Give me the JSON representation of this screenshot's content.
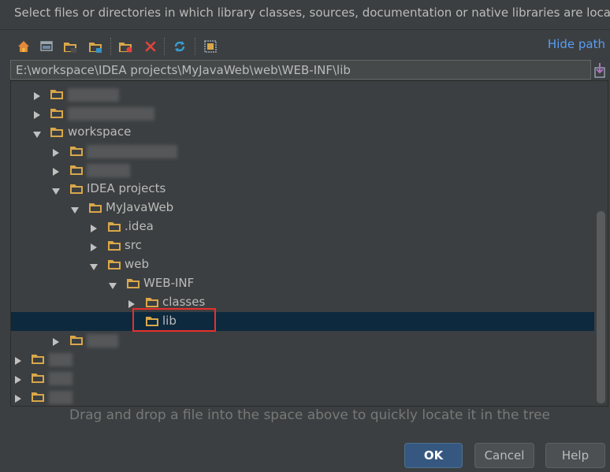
{
  "header": {
    "text": "Select files or directories in which library classes, sources, documentation or native libraries are located"
  },
  "toolbar": {
    "icons": [
      "home-icon",
      "desktop-icon",
      "project-folder-icon",
      "module-folder-icon",
      "new-folder-icon",
      "delete-icon",
      "refresh-icon",
      "show-hidden-icon"
    ],
    "hide_path_label": "Hide path"
  },
  "path_field": {
    "value": "E:\\workspace\\IDEA projects\\MyJavaWeb\\web\\WEB-INF\\lib"
  },
  "tree": {
    "nodes": [
      {
        "label": "",
        "expanded": false,
        "redacted": true
      },
      {
        "label": "",
        "expanded": false,
        "redacted": true
      },
      {
        "label": "workspace",
        "expanded": true
      },
      {
        "label": "",
        "expanded": false,
        "redacted": true
      },
      {
        "label": "",
        "expanded": false,
        "redacted": true
      },
      {
        "label": "IDEA projects",
        "expanded": true
      },
      {
        "label": "MyJavaWeb",
        "expanded": true
      },
      {
        "label": ".idea",
        "expanded": false
      },
      {
        "label": "src",
        "expanded": false
      },
      {
        "label": "web",
        "expanded": true
      },
      {
        "label": "WEB-INF",
        "expanded": true
      },
      {
        "label": "classes",
        "expanded": false
      },
      {
        "label": "lib",
        "selected": true
      },
      {
        "label": "",
        "expanded": false,
        "redacted": true
      },
      {
        "label": "",
        "expanded": false,
        "redacted": true
      },
      {
        "label": "",
        "expanded": false,
        "redacted": true
      },
      {
        "label": "",
        "expanded": false,
        "redacted": true
      }
    ]
  },
  "hint": "Drag and drop a file into the space above to quickly locate it in the tree",
  "buttons": {
    "ok": "OK",
    "cancel": "Cancel",
    "help": "Help"
  },
  "colors": {
    "background": "#3c3f41",
    "selection": "#0d293e",
    "link": "#589df6",
    "folder": "#d9a74a",
    "highlight": "#e8302c",
    "ok_button": "#365880"
  }
}
